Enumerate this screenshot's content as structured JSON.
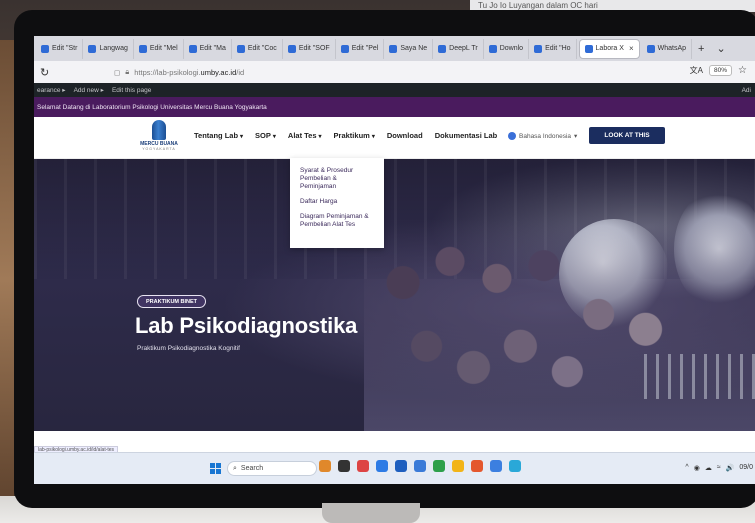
{
  "background_strip_text": "Tu Jo Io Luyangan dalam OC hari",
  "browser": {
    "tabs": [
      {
        "label": "Edit \"Str"
      },
      {
        "label": "Langwag"
      },
      {
        "label": "Edit \"Mel"
      },
      {
        "label": "Edit \"Ma"
      },
      {
        "label": "Edit \"Coc"
      },
      {
        "label": "Edit \"SOF"
      },
      {
        "label": "Edit \"Pel"
      },
      {
        "label": "Saya Ne"
      },
      {
        "label": "DeepL Tr"
      },
      {
        "label": "Downlo"
      },
      {
        "label": "Edit \"Ho"
      },
      {
        "label": "Labora X",
        "active": true
      },
      {
        "label": "WhatsAp"
      }
    ],
    "new_tab": "+",
    "tab_list": "⌄",
    "reload": "↻",
    "url_prefix": "https://lab-psikologi.",
    "url_domain": "umby.ac.id",
    "url_path": "/id",
    "translate": "文A",
    "zoom": "80%",
    "bookmark": "☆"
  },
  "adminbar": {
    "items": [
      "earance ▸",
      "Add new ▸",
      "Edit this page"
    ],
    "right": "Adi"
  },
  "announcement": "Selamat Datang di Laboratorium Psikologi Universitas Mercu Buana Yogyakarta",
  "site": {
    "logo_name": "MERCU BUANA",
    "logo_sub": "YOGYAKARTA",
    "menu": [
      {
        "label": "Tentang Lab",
        "caret": true
      },
      {
        "label": "SOP",
        "caret": true
      },
      {
        "label": "Alat Tes",
        "caret": true
      },
      {
        "label": "Praktikum",
        "caret": true
      },
      {
        "label": "Download",
        "caret": false
      },
      {
        "label": "Dokumentasi Lab",
        "caret": false
      }
    ],
    "language": "Bahasa Indonesia",
    "cta": "LOOK AT THIS"
  },
  "dropdown": [
    "Syarat & Prosedur Pembelian & Peminjaman",
    "Daftar Harga",
    "Diagram Peminjaman & Pembelian Alat Tes"
  ],
  "hero": {
    "badge": "PRAKTIKUM BINET",
    "title": "Lab Psikodiagnostika",
    "subtitle": "Praktikum Psikodiagnostika Kognitif"
  },
  "status_url": "lab-psikologi.umby.ac.id/id/alat-tes",
  "taskbar": {
    "search": "Search",
    "icon_colors": [
      "#e0882b",
      "#333",
      "#d44",
      "#2d7be5",
      "#1f5fbf",
      "#3b7bd8",
      "#2ea04a",
      "#f2b418",
      "#e4572e",
      "#3c7fe0",
      "#2aa8d8"
    ],
    "tray": [
      "^",
      "◉",
      "☁",
      "≈",
      "🔊",
      "09/0"
    ]
  }
}
